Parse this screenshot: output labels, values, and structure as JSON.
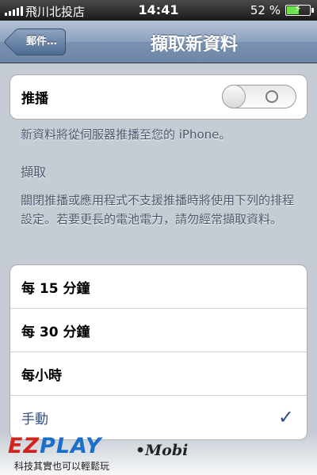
{
  "status_bar": {
    "carrier": "飛川北投店",
    "time": "14:41",
    "battery_pct": "52 %",
    "battery_level": 0.52,
    "signal_bars": 5
  },
  "nav": {
    "back_label": "郵件…",
    "title": "擷取新資料"
  },
  "push": {
    "label": "推播",
    "enabled": false,
    "note": "新資料將從伺服器推播至您的 iPhone。"
  },
  "fetch": {
    "heading": "擷取",
    "note": "關閉推播或應用程式不支援推播時將使用下列的排程設定。若要更長的電池電力，請勿經常擷取資料。",
    "options": [
      {
        "label": "每 15 分鐘",
        "selected": false
      },
      {
        "label": "每 30 分鐘",
        "selected": false
      },
      {
        "label": "每小時",
        "selected": false
      },
      {
        "label": "手動",
        "selected": true
      }
    ]
  },
  "watermark": {
    "logo_ez": "EZ",
    "logo_play": "PLAY",
    "logo_mobi": "•Mobi",
    "slogan": "科技其實也可以輕鬆玩"
  },
  "colors": {
    "selected_text": "#324f85",
    "battery_fill": "#6ce04a"
  }
}
